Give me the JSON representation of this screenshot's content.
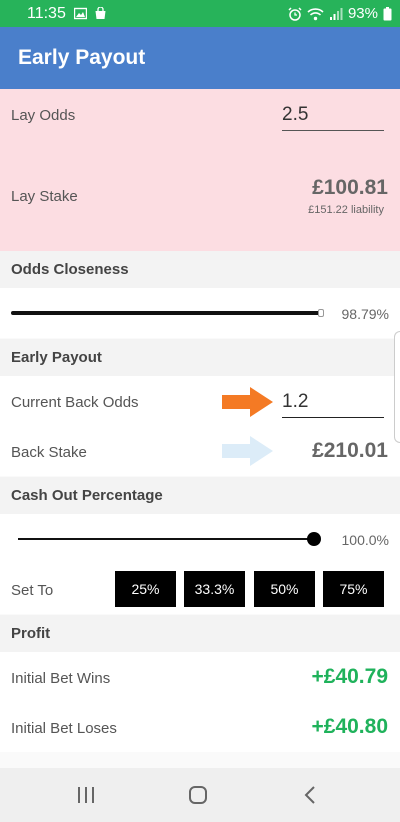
{
  "status_bar": {
    "time": "11:35",
    "battery": "93%"
  },
  "app": {
    "title": "Early Payout"
  },
  "lay": {
    "odds_label": "Lay Odds",
    "odds_value": "2.5",
    "stake_label": "Lay Stake",
    "stake_value": "£100.81",
    "liability": "£151.22 liability"
  },
  "odds_closeness": {
    "heading": "Odds Closeness",
    "percent_text": "98.79%",
    "percent": 98.79
  },
  "early_payout": {
    "heading": "Early Payout",
    "back_odds_label": "Current Back Odds",
    "back_odds_value": "1.2",
    "back_stake_label": "Back Stake",
    "back_stake_value": "£210.01"
  },
  "cash_out": {
    "heading": "Cash Out Percentage",
    "percent_text": "100.0%",
    "percent": 100,
    "set_to_label": "Set To",
    "buttons": [
      "25%",
      "33.3%",
      "50%",
      "75%"
    ]
  },
  "profit": {
    "heading": "Profit",
    "win_label": "Initial Bet Wins",
    "win_value": "+£40.79",
    "lose_label": "Initial Bet Loses",
    "lose_value": "+£40.80"
  },
  "colors": {
    "status_bar": "#27b35a",
    "app_bar": "#4a7fcb",
    "lay_panel": "#fcdde2",
    "profit_green": "#1fb25b",
    "arrow_orange": "#f47a24",
    "arrow_blue": "#dcecf8"
  },
  "icons": {
    "status_left": [
      "image-icon",
      "shopping-bag-icon"
    ],
    "status_right": [
      "alarm-icon",
      "wifi-icon",
      "signal-icon",
      "battery-icon"
    ],
    "nav": [
      "recents-icon",
      "home-icon",
      "back-icon"
    ]
  }
}
